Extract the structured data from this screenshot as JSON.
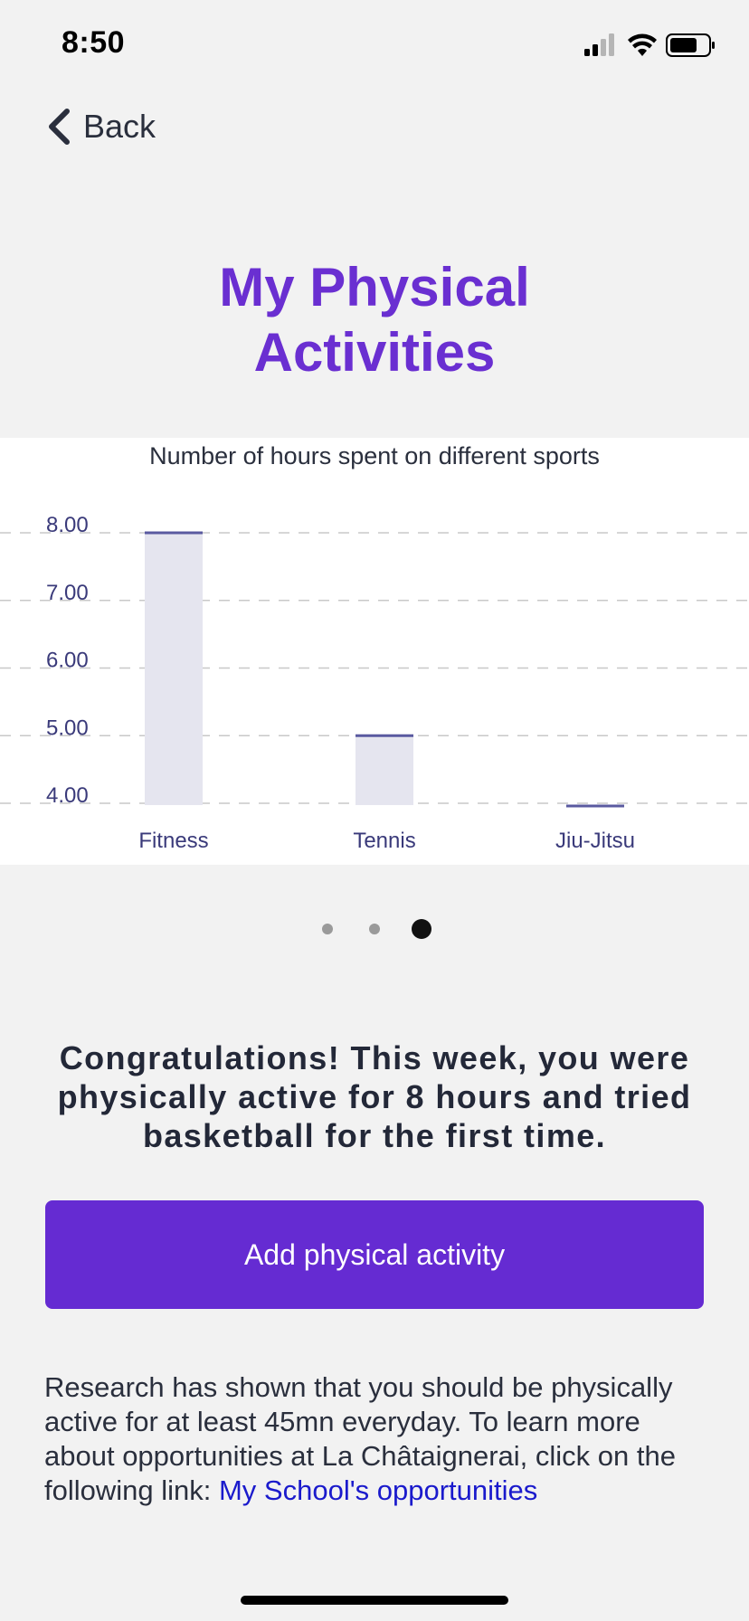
{
  "status_bar": {
    "time": "8:50",
    "icons": [
      "cellular-signal-icon",
      "wifi-icon",
      "battery-icon"
    ]
  },
  "nav": {
    "back_label": "Back",
    "back_icon": "chevron-left-icon"
  },
  "page": {
    "title_line1": "My Physical",
    "title_line2": "Activities"
  },
  "chart_data": {
    "type": "bar",
    "title": "Number of hours spent on different sports",
    "categories": [
      "Fitness",
      "Tennis",
      "Jiu-Jitsu"
    ],
    "values": [
      8,
      5,
      4
    ],
    "ylim": [
      4,
      8
    ],
    "yticks": [
      "8.00",
      "7.00",
      "6.00",
      "5.00",
      "4.00"
    ],
    "grid": true,
    "colors": {
      "bar_fill": "#e5e5ef",
      "bar_top": "#5a5aa0",
      "tick_label": "#3a3a7a",
      "grid": "#c8c8c8"
    }
  },
  "pager": {
    "count": 3,
    "active_index": 2
  },
  "congrats_text": "Congratulations! This week, you were physically active for 8 hours and tried basketball for the first time.",
  "add_button_label": "Add physical activity",
  "research": {
    "text": "Research has shown that you should be physically active for at least 45mn everyday. To learn more about opportunities at La Châtaignerai, click on the following link: ",
    "link_label": "My School's opportunities"
  },
  "colors": {
    "accent": "#652bd2",
    "title": "#6a2fd1",
    "background": "#f2f2f2",
    "link": "#1a1acc"
  }
}
